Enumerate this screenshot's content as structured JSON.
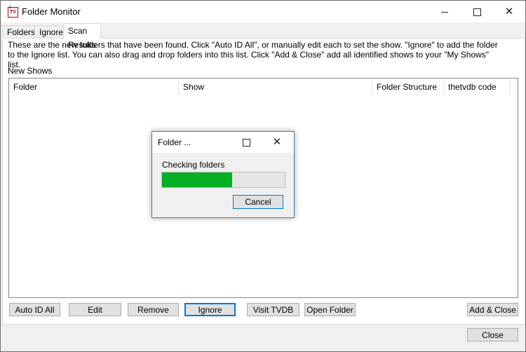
{
  "window": {
    "title": "Folder Monitor",
    "icon": "tv-icon"
  },
  "tabs": [
    {
      "label": "Folders"
    },
    {
      "label": "Ignore"
    },
    {
      "label": "Scan Results"
    }
  ],
  "active_tab": "Scan Results",
  "description": {
    "line1": "These are the new folders that have been found.  Click \"Auto ID All\", or manually edit each to set the show.  \"Ignore\" to add the folder",
    "line2": "to the Ignore list.  You can also drag and drop folders into this list.  Click \"Add & Close\" add all identified shows to your \"My Shows\" list."
  },
  "list_label": "New Shows",
  "columns": [
    "Folder",
    "Show",
    "Folder Structure",
    "thetvdb code"
  ],
  "rows": [],
  "buttons": {
    "auto_id_all": "Auto ID All",
    "edit": "Edit",
    "remove": "Remove",
    "ignore": "Ignore",
    "visit_tvdb": "Visit TVDB",
    "open_folder": "Open Folder",
    "add_close": "Add & Close",
    "close": "Close"
  },
  "dialog": {
    "title": "Folder ...",
    "status": "Checking folders",
    "progress_percent": 57,
    "cancel": "Cancel",
    "progress_color": "#06b025"
  },
  "colors": {
    "accent": "#0078d7",
    "window_bg": "#f0f0f0"
  }
}
